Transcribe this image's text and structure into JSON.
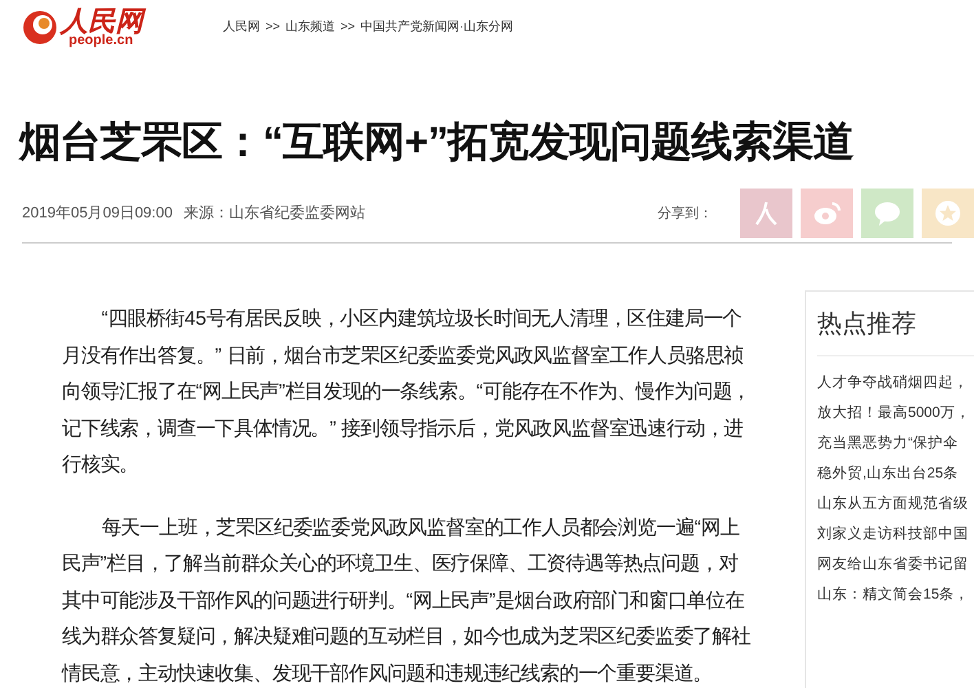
{
  "header": {
    "logo_main": "人民网",
    "logo_sub": "people.cn",
    "breadcrumbs": [
      "人民网",
      "山东频道",
      "中国共产党新闻网·山东分网"
    ],
    "separator": ">>"
  },
  "article": {
    "title": "烟台芝罘区：“互联网+”拓宽发现问题线索渠道",
    "date": "2019年05月09日09:00",
    "source": "来源：山东省纪委监委网站",
    "share_label": "分享到：",
    "share_buttons": [
      {
        "kind": "people",
        "color": "#e9c6cc"
      },
      {
        "kind": "weibo",
        "color": "#f6cdcd"
      },
      {
        "kind": "wechat",
        "color": "#cfe8c6"
      },
      {
        "kind": "star",
        "color": "#f8e6c6"
      }
    ],
    "paragraphs": [
      "“四眼桥街45号有居民反映，小区内建筑垃圾长时间无人清理，区住建局一个月没有作出答复。” 日前，烟台市芝罘区纪委监委党风政风监督室工作人员骆思祯向领导汇报了在“网上民声”栏目发现的一条线索。“可能存在不作为、慢作为问题，记下线索，调查一下具体情况。” 接到领导指示后，党风政风监督室迅速行动，进行核实。",
      "每天一上班，芝罘区纪委监委党风政风监督室的工作人员都会浏览一遍“网上民声”栏目，了解当前群众关心的环境卫生、医疗保障、工资待遇等热点问题，对其中可能涉及干部作风的问题进行研判。“网上民声”是烟台政府部门和窗口单位在线为群众答复疑问，解决疑难问题的互动栏目，如今也成为芝罘区纪委监委了解社情民意，主动快速收集、发现干部作风问题和违规违纪线索的一个重要渠道。"
    ]
  },
  "sidebar": {
    "title": "热点推荐",
    "items": [
      "人才争夺战硝烟四起，",
      "放大招！最高5000万，",
      "充当黑恶势力“保护伞",
      "稳外贸,山东出台25条",
      "山东从五方面规范省级",
      "刘家义走访科技部中国",
      "网友给山东省委书记留",
      "山东：精文简会15条，"
    ]
  }
}
